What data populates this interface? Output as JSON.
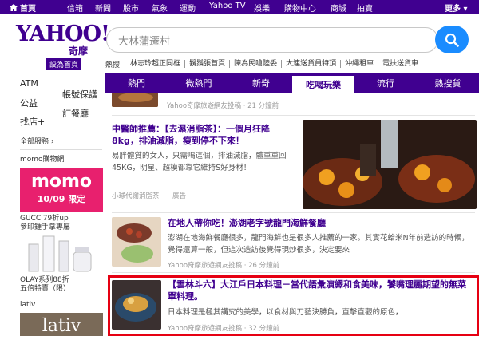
{
  "topbar": {
    "home": "首頁",
    "items": [
      "信箱",
      "新聞",
      "股市",
      "氣象",
      "運動",
      "Yahoo TV",
      "娛樂",
      "購物中心",
      "商城",
      "拍賣"
    ],
    "more": "更多"
  },
  "header": {
    "logo_text": "YAHOO!",
    "logo_cn": "奇摩",
    "set_home": "設為首頁"
  },
  "search": {
    "value": "大林蒲遷村"
  },
  "hot": {
    "label": "熱搜:",
    "items": [
      "林志玲超正同框",
      "鬍鬚張首頁",
      "陳為民嗆陸委",
      "大連送貨員特頂",
      "沖繩租車",
      "電扶送貨車"
    ]
  },
  "sidebar": {
    "atm": "ATM",
    "bill": "帳號保護",
    "pub": "公益",
    "order": "訂餐廳",
    "house": "找店+",
    "all": "全部服務",
    "all_arrow": "›",
    "momo_section": "momo購物網",
    "momo_line1": "momo",
    "momo_line2": "10/09 限定",
    "ad1_l1": "GUCCI79折up",
    "ad1_l2": "參印鍾手拿專屬",
    "ad2_l1": "OLAY系列88折",
    "ad2_l2": "五倍特賣（限）",
    "lativ_section": "lativ",
    "lativ_logo": "lativ"
  },
  "tabs": [
    "熱門",
    "微熱門",
    "新奇",
    "吃喝玩樂",
    "流行",
    "熱搜貨"
  ],
  "active_tab": "吃喝玩樂",
  "articles": [
    {
      "meta": "Yahoo奇摩旅遊網友投稿 · 21 分鐘前"
    },
    {
      "title": "中醫師推薦：【去濕消脂茶】：一個月狂降8kg，排油減脂，瘦到停不下來！",
      "snippet": "易胖體質的女人，只需喝這個，排油減脂，體重重回45KG，明星、超模都靠它維持S好身材！",
      "meta_source": "小球代謝消脂茶",
      "meta_ad": "廣告"
    },
    {
      "title": "在地人帶你吃！澎湖老字號龍門海鮮餐廳",
      "snippet": "澎湖在地海鮮餐廳很多，龍門海鮮也是很多人推薦的一家。其實花蛤米N年前造訪的時候，覺得還算一般，但這次造訪後覺得現炒很多，決定要來",
      "meta": "Yahoo奇摩旅遊網友投稿 · 26 分鐘前"
    },
    {
      "title": "【雲林斗六】大江戶日本料理－當代語彙演繹和食美味，饕嘴理麗期望的無菜單料理。",
      "snippet": "日本料理是極其講究的美學，以食材與刀藝決勝負，直擊直觀的原色，",
      "meta": "Yahoo奇摩旅遊網友投稿 · 32 分鐘前"
    }
  ],
  "colors": {
    "brand": "#400090",
    "search_button": "#1a8cff",
    "highlight_border": "#e60012",
    "momo": "#e8206e"
  }
}
